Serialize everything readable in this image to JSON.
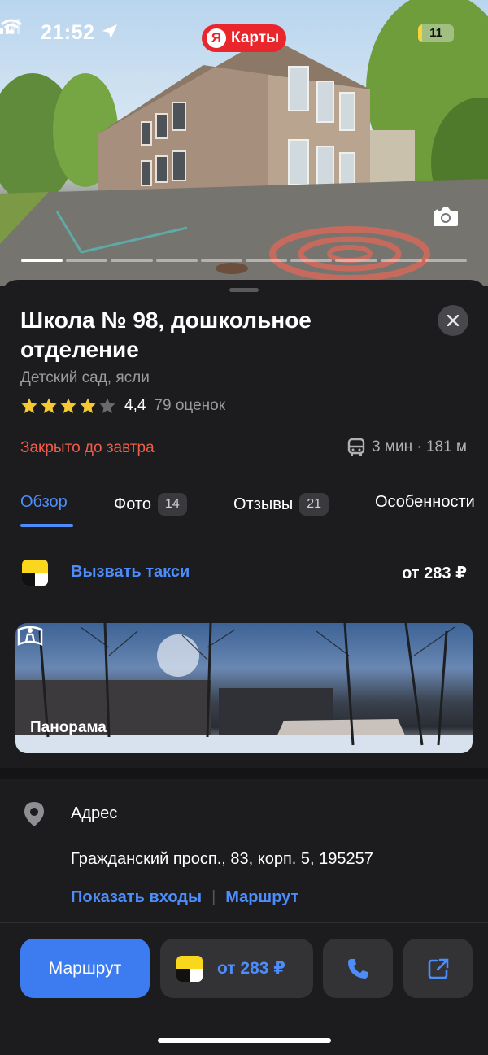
{
  "status_bar": {
    "time": "21:52",
    "battery": "11",
    "battery_level": 0.11
  },
  "app_badge": {
    "logo": "Я",
    "label": "Карты"
  },
  "hero": {
    "photo_count": "14",
    "pages": 10,
    "active_page": 0
  },
  "place": {
    "title": "Школа № 98, дошкольное отделение",
    "category": "Детский сад, ясли",
    "rating_value": "4,4",
    "rating_stars": 4.4,
    "rating_count": "79 оценок",
    "status": "Закрыто до завтра",
    "transit": "3 мин · 181 м"
  },
  "tabs": [
    {
      "label": "Обзор",
      "badge": ""
    },
    {
      "label": "Фото",
      "badge": "14"
    },
    {
      "label": "Отзывы",
      "badge": "21"
    },
    {
      "label": "Особенности",
      "badge": ""
    }
  ],
  "taxi": {
    "label": "Вызвать такси",
    "price": "от 283 ₽"
  },
  "panorama": {
    "label": "Панорама"
  },
  "address": {
    "title": "Адрес",
    "line": "Гражданский просп., 83, корп. 5, 195257",
    "show_entrances": "Показать входы",
    "route_link": "Маршрут"
  },
  "actions": {
    "route": "Маршрут",
    "taxi_price": "от 283 ₽"
  },
  "colors": {
    "accent": "#4d8dfb",
    "closed": "#f05c4a",
    "background": "#1c1c1e",
    "taxi_yellow": "#f9d71c"
  }
}
